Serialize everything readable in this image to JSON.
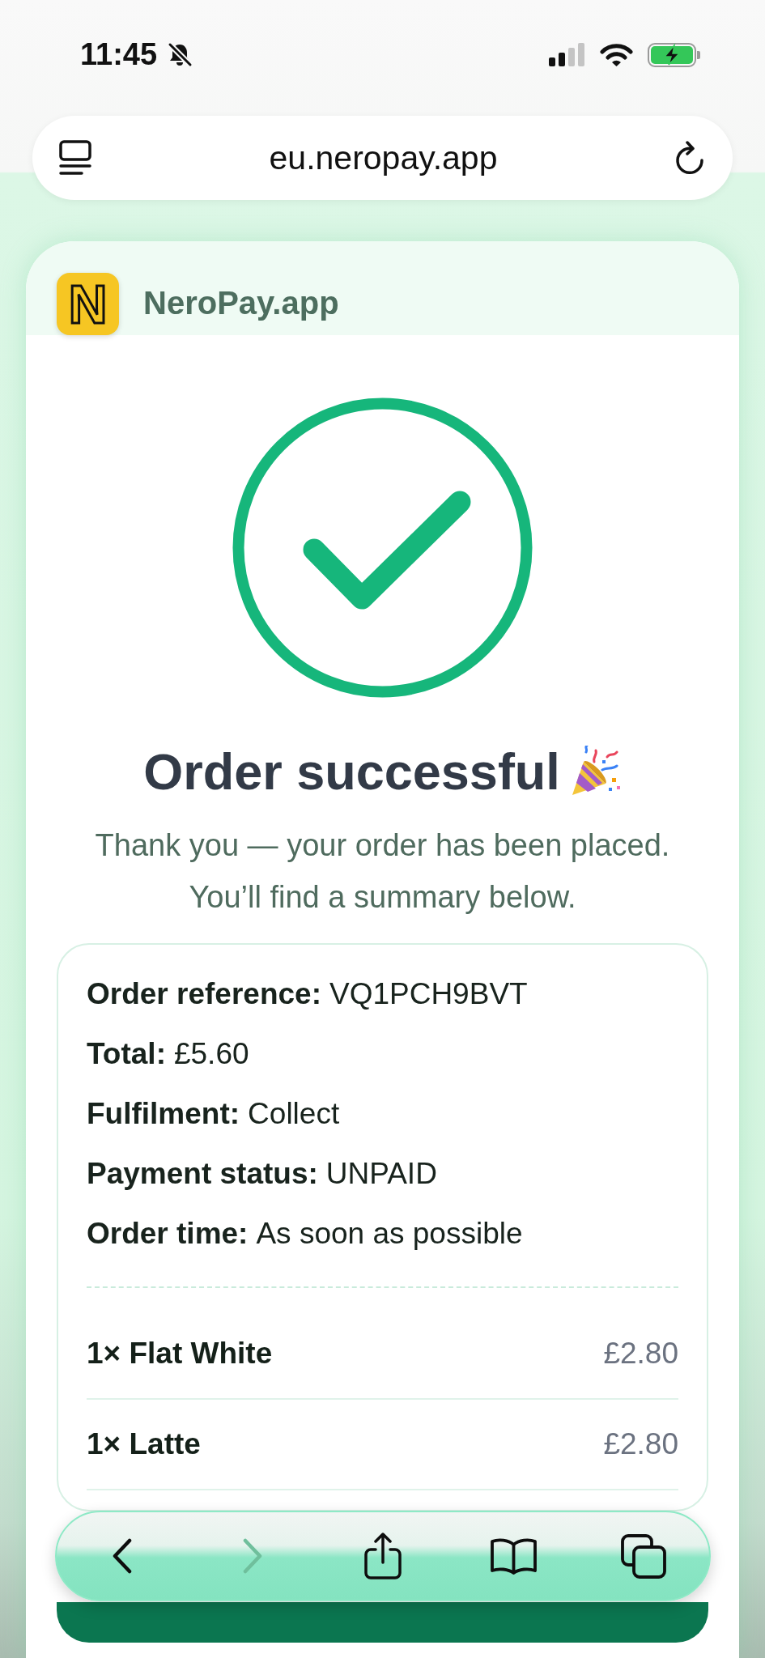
{
  "status_bar": {
    "time": "11:45",
    "silent": true
  },
  "address_bar": {
    "url": "eu.neropay.app"
  },
  "brand": {
    "logo_letter": "N",
    "name": "NeroPay.app"
  },
  "confirmation": {
    "title": "Order successful",
    "message": "Thank you — your order has been placed. You’ll find a summary below."
  },
  "summary": {
    "fields": [
      {
        "label": "Order reference:",
        "value": "VQ1PCH9BVT"
      },
      {
        "label": "Total:",
        "value": "£5.60"
      },
      {
        "label": "Fulfilment:",
        "value": "Collect"
      },
      {
        "label": "Payment status:",
        "value": "UNPAID"
      },
      {
        "label": "Order time:",
        "value": "As soon as possible"
      }
    ],
    "items": [
      {
        "name": "1× Flat White",
        "price": "£2.80"
      },
      {
        "name": "1× Latte",
        "price": "£2.80"
      }
    ]
  },
  "toolbar": {
    "buttons": [
      {
        "kind": "back",
        "disabled": false
      },
      {
        "kind": "forward",
        "disabled": true
      },
      {
        "kind": "share",
        "disabled": false
      },
      {
        "kind": "bookmarks",
        "disabled": false
      },
      {
        "kind": "tabs",
        "disabled": false
      }
    ]
  }
}
